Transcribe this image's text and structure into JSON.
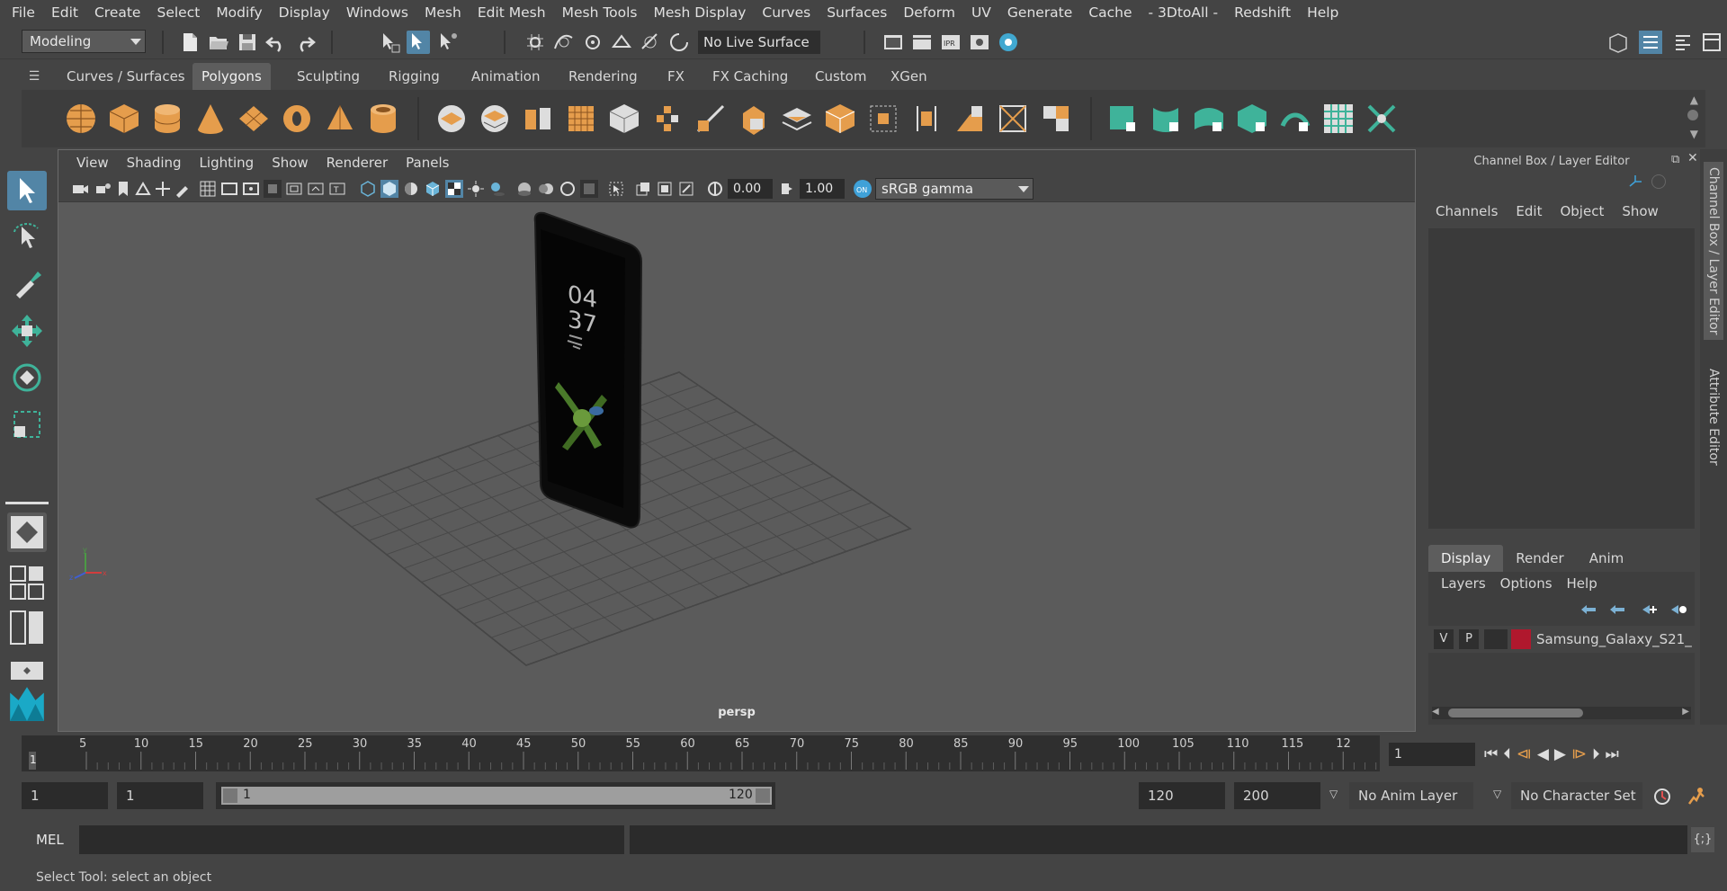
{
  "menubar": {
    "items": [
      "File",
      "Edit",
      "Create",
      "Select",
      "Modify",
      "Display",
      "Windows",
      "Mesh",
      "Edit Mesh",
      "Mesh Tools",
      "Mesh Display",
      "Curves",
      "Surfaces",
      "Deform",
      "UV",
      "Generate",
      "Cache",
      "- 3DtoAll -",
      "Redshift",
      "Help"
    ]
  },
  "statusline": {
    "mode": "Modeling",
    "live_surface": "No Live Surface"
  },
  "shelf": {
    "tabs": [
      "Curves / Surfaces",
      "Polygons",
      "Sculpting",
      "Rigging",
      "Animation",
      "Rendering",
      "FX",
      "FX Caching",
      "Custom",
      "XGen"
    ],
    "active_tab": "Polygons"
  },
  "viewport": {
    "menu": [
      "View",
      "Shading",
      "Lighting",
      "Show",
      "Renderer",
      "Panels"
    ],
    "exposure": "0.00",
    "gamma": "1.00",
    "color_space": "sRGB gamma",
    "camera_label": "persp",
    "phone_time_h": "04",
    "phone_time_m": "37"
  },
  "channelbox": {
    "title": "Channel Box / Layer Editor",
    "menu": [
      "Channels",
      "Edit",
      "Object",
      "Show"
    ],
    "layer_tabs": [
      "Display",
      "Render",
      "Anim"
    ],
    "active_layer_tab": "Display",
    "layer_menu": [
      "Layers",
      "Options",
      "Help"
    ],
    "layer": {
      "v": "V",
      "p": "P",
      "name": "Samsung_Galaxy_S21_",
      "color": "#b0182d"
    }
  },
  "side_tabs": [
    "Channel Box / Layer Editor",
    "Attribute Editor"
  ],
  "timeline": {
    "ticks": [
      "5",
      "10",
      "15",
      "20",
      "25",
      "30",
      "35",
      "40",
      "45",
      "50",
      "55",
      "60",
      "65",
      "70",
      "75",
      "80",
      "85",
      "90",
      "95",
      "100",
      "105",
      "110",
      "115",
      "12"
    ],
    "start_marker": "1",
    "current_frame": "1"
  },
  "range": {
    "start": "1",
    "anim_start": "1",
    "slider_start": "1",
    "slider_end": "120",
    "range_end": "120",
    "anim_end": "200",
    "anim_layer": "No Anim Layer",
    "char_set": "No Character Set"
  },
  "mel": {
    "label": "MEL"
  },
  "help": {
    "text": "Select Tool: select an object"
  },
  "colors": {
    "accent": "#5285a6",
    "shelf_orange": "#e59d4c",
    "shelf_teal": "#3fb39a"
  }
}
